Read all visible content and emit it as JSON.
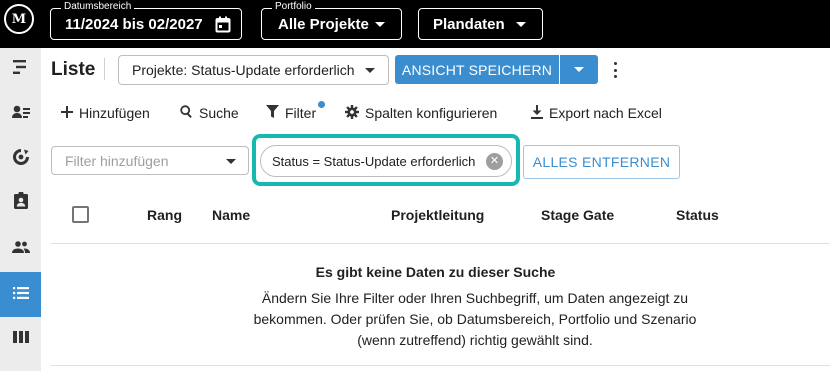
{
  "app": {
    "logo_text": "M"
  },
  "topbar": {
    "date_range": {
      "legend": "Datumsbereich",
      "value": "11/2024 bis 02/2027",
      "icon": "calendar-icon"
    },
    "portfolio": {
      "legend": "Portfolio",
      "value": "Alle Projekte"
    },
    "dataset": {
      "value": "Plandaten"
    }
  },
  "sidebar": {
    "items": [
      {
        "name": "timeline",
        "icon": "timeline-icon"
      },
      {
        "name": "people",
        "icon": "user-list-icon"
      },
      {
        "name": "cycle",
        "icon": "cycle-icon"
      },
      {
        "name": "assignment",
        "icon": "clipboard-person-icon"
      },
      {
        "name": "team",
        "icon": "group-icon"
      },
      {
        "name": "list",
        "icon": "list-icon",
        "active": true
      },
      {
        "name": "board",
        "icon": "columns-icon"
      }
    ]
  },
  "header": {
    "title": "Liste",
    "view_select": "Projekte: Status-Update erforderlich",
    "save_button": "ANSICHT SPEICHERN"
  },
  "toolbar": {
    "add": "Hinzufügen",
    "search": "Suche",
    "filter": "Filter",
    "columns": "Spalten konfigurieren",
    "export": "Export nach Excel"
  },
  "filters": {
    "placeholder": "Filter hinzufügen",
    "active_chip": "Status = Status-Update erforderlich",
    "remove_all": "ALLES ENTFERNEN"
  },
  "table": {
    "columns": [
      "Rang",
      "Name",
      "Projektleitung",
      "Stage Gate",
      "Status"
    ]
  },
  "empty_state": {
    "title": "Es gibt keine Daten zu dieser Suche",
    "message": "Ändern Sie Ihre Filter oder Ihren Suchbegriff, um Daten angezeigt zu bekommen. Oder prüfen Sie, ob Datumsbereich, Portfolio und Szenario (wenn zutreffend) richtig gewählt sind."
  },
  "colors": {
    "accent": "#3a8ecf",
    "highlight": "#17b8b0",
    "topbar": "#000000",
    "sidebar": "#ececec"
  }
}
